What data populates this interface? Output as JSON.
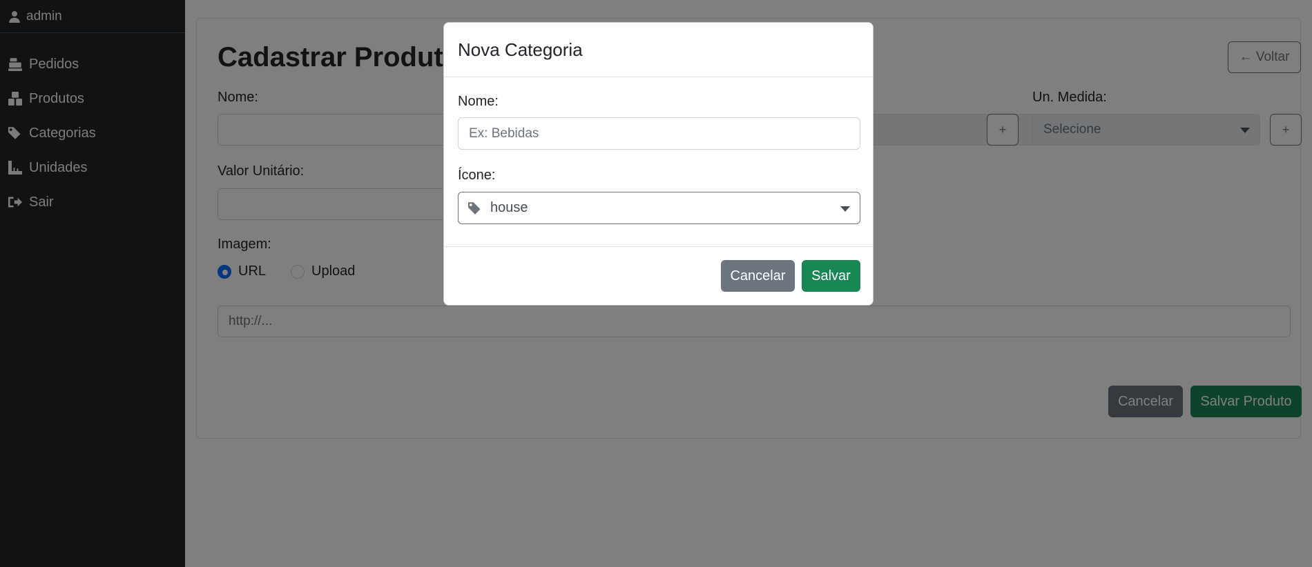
{
  "sidebar": {
    "user": {
      "icon": "user-icon",
      "name": "admin"
    },
    "items": [
      {
        "icon": "cash-register-icon",
        "label": "Pedidos"
      },
      {
        "icon": "boxes-icon",
        "label": "Produtos"
      },
      {
        "icon": "tags-icon",
        "label": "Categorias"
      },
      {
        "icon": "ruler-icon",
        "label": "Unidades"
      },
      {
        "icon": "sign-out-icon",
        "label": "Sair"
      }
    ]
  },
  "page": {
    "title": "Cadastrar Produto",
    "back_button": "← Voltar",
    "fields": {
      "nome_label": "Nome:",
      "un_medida_label": "Un. Medida:",
      "un_medida_value": "Selecione",
      "add_button": "+",
      "valor_label": "Valor Unitário:",
      "imagem_label": "Imagem:",
      "radio_url": "URL",
      "radio_upload": "Upload",
      "url_placeholder": "http://..."
    },
    "footer": {
      "cancel": "Cancelar",
      "save": "Salvar Produto"
    }
  },
  "modal": {
    "title": "Nova Categoria",
    "nome_label": "Nome:",
    "nome_placeholder": "Ex: Bebidas",
    "icone_label": "Ícone:",
    "icone_value": "house",
    "icone_icon": "tag-icon",
    "cancel": "Cancelar",
    "save": "Salvar"
  },
  "colors": {
    "sidebar_bg": "#212529",
    "primary": "#0d6efd",
    "success": "#198754",
    "secondary": "#6c757d"
  }
}
